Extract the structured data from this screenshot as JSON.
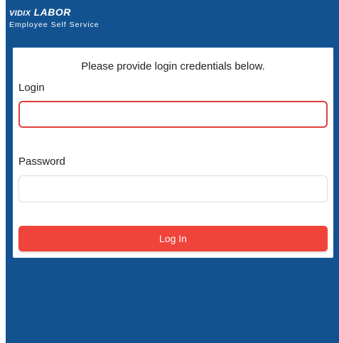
{
  "brand": {
    "logo_part_a": "VIDIX",
    "logo_part_b": "LABOR",
    "subtitle": "Employee Self Service"
  },
  "login_form": {
    "prompt": "Please provide login credentials below.",
    "login_label": "Login",
    "login_value": "",
    "login_placeholder": "",
    "password_label": "Password",
    "password_value": "",
    "password_placeholder": "",
    "submit_label": "Log In"
  },
  "colors": {
    "header_background": "#135290",
    "accent_button": "#f0433a",
    "focused_input_border": "#e0403a"
  }
}
